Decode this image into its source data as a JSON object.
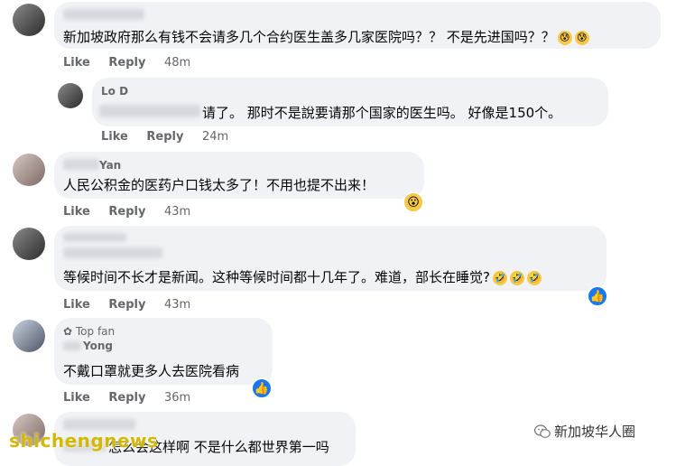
{
  "comments": [
    {
      "text": "新加坡政府那么有钱不会请多几个合约医生盖多几家医院吗？？ 不是先进国吗？？",
      "like": "Like",
      "reply": "Reply",
      "time": "48m",
      "emoji": "😰"
    },
    {
      "name": "Lo D",
      "text": "请了。 那时不是說要请那个国家的医生吗。 好像是150个。",
      "like": "Like",
      "reply": "Reply",
      "time": "24m"
    },
    {
      "name": "Yan",
      "text": "人民公积金的医药户口钱太多了！不用也提不出来！",
      "like": "Like",
      "reply": "Reply",
      "time": "43m",
      "reaction": "😮"
    },
    {
      "text": "等候时间不长才是新闻。这种等候时间都十几年了。难道，部长在睡觉?",
      "like": "Like",
      "reply": "Reply",
      "time": "43m",
      "emoji": "🤣",
      "reaction": "👍"
    },
    {
      "badge": "Top fan",
      "name": "Yong",
      "text": "不戴口罩就更多人去医院看病",
      "like": "Like",
      "reply": "Reply",
      "time": "36m",
      "reaction": "👍"
    },
    {
      "text": "怎么会这样啊 不是什么都世界第一吗"
    }
  ],
  "watermark": "shichengnews",
  "brand": "新加坡华人圈"
}
